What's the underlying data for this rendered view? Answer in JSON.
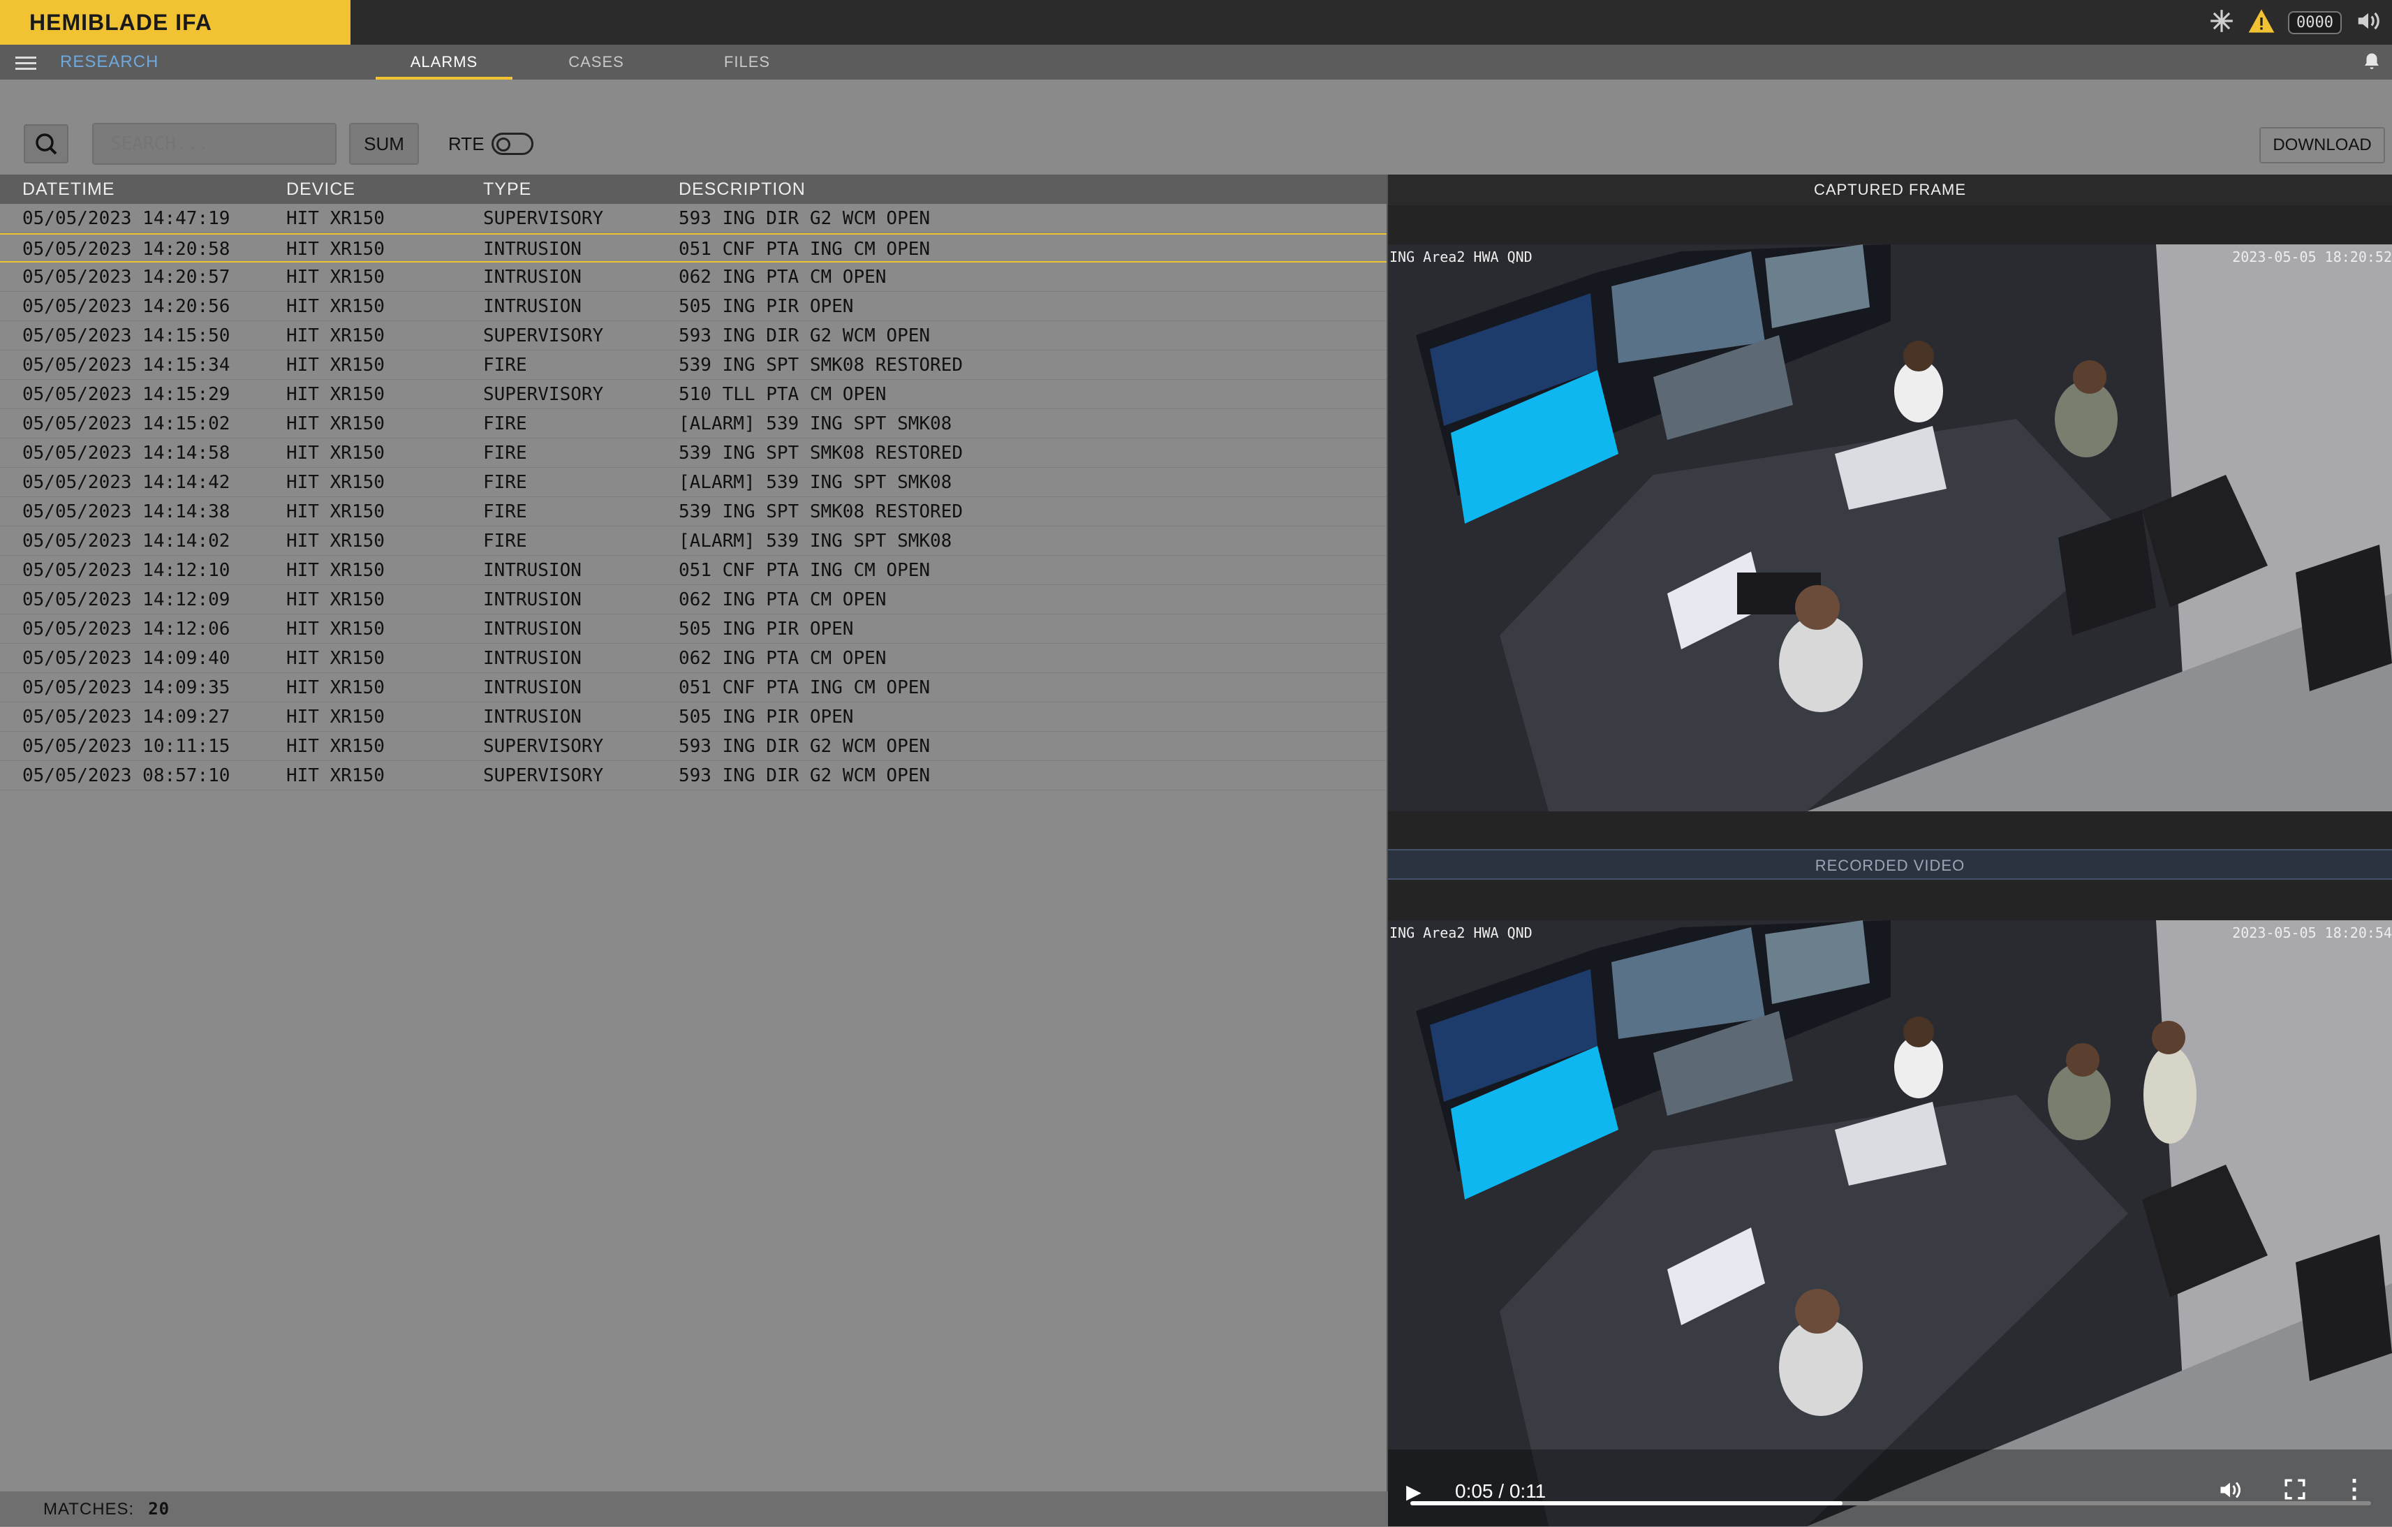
{
  "app": {
    "title": "HEMIBLADE IFA",
    "counter": "0000"
  },
  "nav": {
    "section": "RESEARCH",
    "tabs": [
      "ALARMS",
      "CASES",
      "FILES"
    ],
    "active_tab": "ALARMS"
  },
  "toolbar": {
    "search_placeholder": "SEARCH...",
    "sum_label": "SUM",
    "rte_label": "RTE",
    "rte_on": false,
    "download_label": "DOWNLOAD"
  },
  "table": {
    "columns": [
      "DATETIME",
      "DEVICE",
      "TYPE",
      "DESCRIPTION"
    ],
    "selected_row": 1,
    "rows": [
      [
        "05/05/2023 14:47:19",
        "HIT XR150",
        "SUPERVISORY",
        "593 ING DIR G2 WCM OPEN"
      ],
      [
        "05/05/2023 14:20:58",
        "HIT XR150",
        "INTRUSION",
        "051 CNF PTA ING CM OPEN"
      ],
      [
        "05/05/2023 14:20:57",
        "HIT XR150",
        "INTRUSION",
        "062 ING PTA CM OPEN"
      ],
      [
        "05/05/2023 14:20:56",
        "HIT XR150",
        "INTRUSION",
        "505 ING PIR OPEN"
      ],
      [
        "05/05/2023 14:15:50",
        "HIT XR150",
        "SUPERVISORY",
        "593 ING DIR G2 WCM OPEN"
      ],
      [
        "05/05/2023 14:15:34",
        "HIT XR150",
        "FIRE",
        "539 ING SPT SMK08 RESTORED"
      ],
      [
        "05/05/2023 14:15:29",
        "HIT XR150",
        "SUPERVISORY",
        "510 TLL PTA CM OPEN"
      ],
      [
        "05/05/2023 14:15:02",
        "HIT XR150",
        "FIRE",
        "[ALARM] 539 ING SPT SMK08"
      ],
      [
        "05/05/2023 14:14:58",
        "HIT XR150",
        "FIRE",
        "539 ING SPT SMK08 RESTORED"
      ],
      [
        "05/05/2023 14:14:42",
        "HIT XR150",
        "FIRE",
        "[ALARM] 539 ING SPT SMK08"
      ],
      [
        "05/05/2023 14:14:38",
        "HIT XR150",
        "FIRE",
        "539 ING SPT SMK08 RESTORED"
      ],
      [
        "05/05/2023 14:14:02",
        "HIT XR150",
        "FIRE",
        "[ALARM] 539 ING SPT SMK08"
      ],
      [
        "05/05/2023 14:12:10",
        "HIT XR150",
        "INTRUSION",
        "051 CNF PTA ING CM OPEN"
      ],
      [
        "05/05/2023 14:12:09",
        "HIT XR150",
        "INTRUSION",
        "062 ING PTA CM OPEN"
      ],
      [
        "05/05/2023 14:12:06",
        "HIT XR150",
        "INTRUSION",
        "505 ING PIR OPEN"
      ],
      [
        "05/05/2023 14:09:40",
        "HIT XR150",
        "INTRUSION",
        "062 ING PTA CM OPEN"
      ],
      [
        "05/05/2023 14:09:35",
        "HIT XR150",
        "INTRUSION",
        "051 CNF PTA ING CM OPEN"
      ],
      [
        "05/05/2023 14:09:27",
        "HIT XR150",
        "INTRUSION",
        "505 ING PIR OPEN"
      ],
      [
        "05/05/2023 10:11:15",
        "HIT XR150",
        "SUPERVISORY",
        "593 ING DIR G2 WCM OPEN"
      ],
      [
        "05/05/2023 08:57:10",
        "HIT XR150",
        "SUPERVISORY",
        "593 ING DIR G2 WCM OPEN"
      ]
    ]
  },
  "status": {
    "matches_label": "MATCHES:",
    "matches_value": "20"
  },
  "captured": {
    "header": "CAPTURED FRAME",
    "camera_label": "ING Area2 HWA QND",
    "timestamp": "2023-05-05 18:20:52"
  },
  "recorded": {
    "header": "RECORDED VIDEO",
    "camera_label": "ING Area2 HWA QND",
    "timestamp": "2023-05-05 18:20:54",
    "time_display": "0:05 / 0:11",
    "progress": 0.45
  },
  "colors": {
    "accent": "#f1c232",
    "link": "#6fa8dc"
  }
}
